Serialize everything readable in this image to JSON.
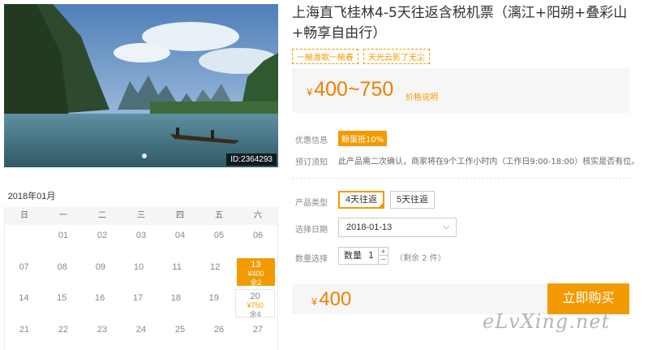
{
  "photo": {
    "id_label": "ID:2364293"
  },
  "product": {
    "title": "上海直飞桂林4-5天往返含税机票（漓江+阳朔+叠彩山+畅享自由行）",
    "tags": [
      "一榆渔歌一榆春",
      "天光云影了无尘"
    ],
    "price_range": "400~750",
    "currency": "¥",
    "price_note": "价格说明"
  },
  "info": {
    "promo_label": "优惠信息",
    "promo_badge": "鲸蛋抵10%",
    "notice_label": "预订须知",
    "notice_text": "此产品需二次确认，商家将在9个工作小时内（工作日9:00-18:00）核实是否有位。"
  },
  "options": {
    "type_label": "产品类型",
    "types": [
      "4天往返",
      "5天往返"
    ],
    "date_label": "选择日期",
    "date_value": "2018-01-13",
    "qty_label": "数量选择",
    "qty_prefix": "数量",
    "qty_value": "1",
    "remain_text": "（剩余 2 件）"
  },
  "buy": {
    "total": "400",
    "button_label": "立即购买"
  },
  "calendar": {
    "month": "2018年01月",
    "weekdays": [
      "日",
      "一",
      "二",
      "三",
      "四",
      "五",
      "六"
    ],
    "rows": [
      [
        "",
        "01",
        "02",
        "03",
        "04",
        "05",
        "06"
      ],
      [
        "07",
        "08",
        "09",
        "10",
        "11",
        "12",
        "13"
      ],
      [
        "14",
        "15",
        "16",
        "17",
        "18",
        "19",
        "20"
      ],
      [
        "21",
        "22",
        "23",
        "24",
        "25",
        "26",
        "27"
      ]
    ],
    "selected": {
      "day": "13",
      "price": "¥400",
      "left": "余2"
    },
    "available": {
      "day": "20",
      "price": "¥750",
      "left": "余4"
    }
  },
  "watermark": "eLvXing.net",
  "colors": {
    "accent": "#f39a00",
    "price": "#f37d00"
  }
}
